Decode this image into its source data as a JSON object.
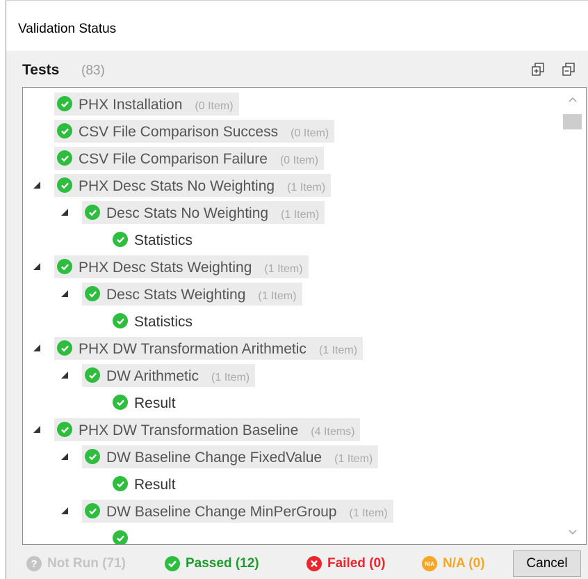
{
  "window": {
    "title": "Validation Status"
  },
  "header": {
    "label": "Tests",
    "count": "(83)"
  },
  "tree": [
    {
      "level": 0,
      "expander": false,
      "label": "PHX Installation",
      "count": "(0 Item)",
      "highlight": true
    },
    {
      "level": 0,
      "expander": false,
      "label": "CSV File Comparison Success",
      "count": "(0 Item)",
      "highlight": true
    },
    {
      "level": 0,
      "expander": false,
      "label": "CSV File Comparison Failure",
      "count": "(0 Item)",
      "highlight": true
    },
    {
      "level": 0,
      "expander": true,
      "label": "PHX Desc Stats No Weighting",
      "count": "(1 Item)",
      "highlight": true
    },
    {
      "level": 1,
      "expander": true,
      "label": "Desc Stats No Weighting",
      "count": "(1 Item)",
      "highlight": true
    },
    {
      "level": 2,
      "expander": false,
      "label": "Statistics",
      "count": "",
      "highlight": false
    },
    {
      "level": 0,
      "expander": true,
      "label": "PHX Desc Stats Weighting",
      "count": "(1 Item)",
      "highlight": true
    },
    {
      "level": 1,
      "expander": true,
      "label": "Desc Stats Weighting",
      "count": "(1 Item)",
      "highlight": true
    },
    {
      "level": 2,
      "expander": false,
      "label": "Statistics",
      "count": "",
      "highlight": false
    },
    {
      "level": 0,
      "expander": true,
      "label": "PHX DW Transformation Arithmetic",
      "count": "(1 Item)",
      "highlight": true
    },
    {
      "level": 1,
      "expander": true,
      "label": "DW Arithmetic",
      "count": "(1 Item)",
      "highlight": true
    },
    {
      "level": 2,
      "expander": false,
      "label": "Result",
      "count": "",
      "highlight": false
    },
    {
      "level": 0,
      "expander": true,
      "label": "PHX DW Transformation Baseline",
      "count": "(4 Items)",
      "highlight": true
    },
    {
      "level": 1,
      "expander": true,
      "label": "DW Baseline Change FixedValue",
      "count": "(1 Item)",
      "highlight": true
    },
    {
      "level": 2,
      "expander": false,
      "label": "Result",
      "count": "",
      "highlight": false
    },
    {
      "level": 1,
      "expander": true,
      "label": "DW Baseline Change MinPerGroup",
      "count": "(1 Item)",
      "highlight": true
    },
    {
      "level": 2,
      "expander": false,
      "label": "",
      "count": "",
      "highlight": false
    }
  ],
  "footer": {
    "not_run": "Not Run (71)",
    "passed": "Passed (12)",
    "failed": "Failed (0)",
    "na": "N/A (0)",
    "na_icon_text": "N/A",
    "not_run_icon_text": "?",
    "cancel": "Cancel"
  },
  "colors": {
    "passed": "#2ebd3f",
    "failed": "#e8282c",
    "na": "#f5a623",
    "not_run": "#c4c4c4"
  }
}
